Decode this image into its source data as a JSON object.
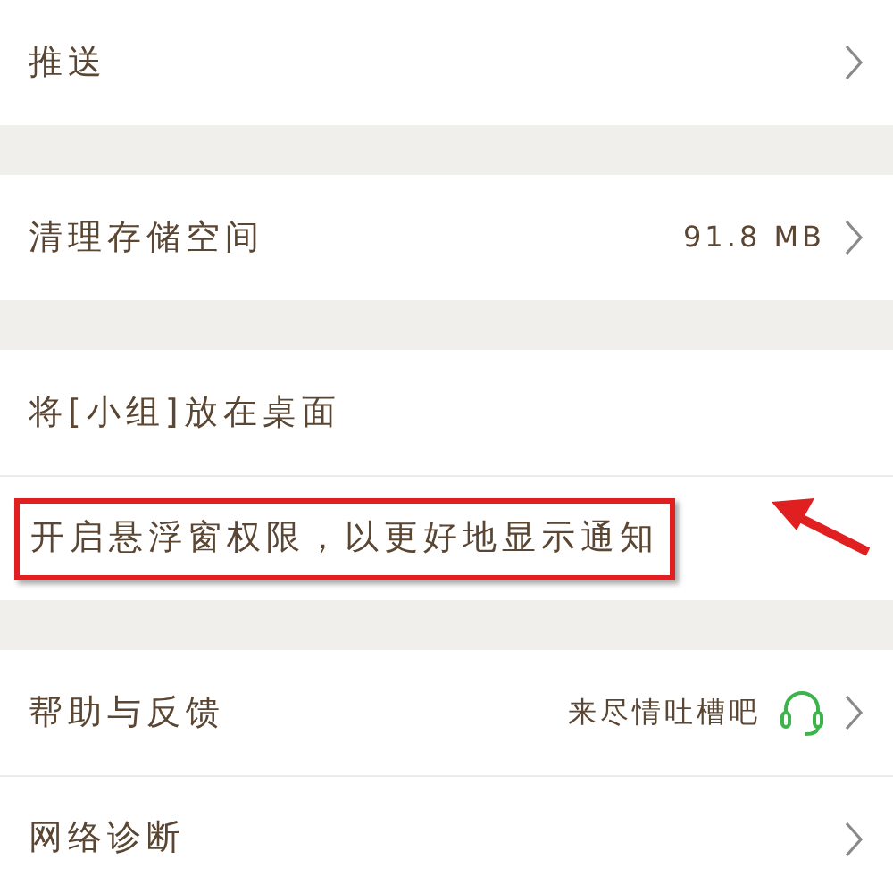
{
  "groups": [
    {
      "items": [
        {
          "label": "推送",
          "chevron": true,
          "headset": false,
          "highlighted": false
        }
      ]
    },
    {
      "items": [
        {
          "label": "清理存储空间",
          "value": "91.8 MB",
          "chevron": true,
          "headset": false,
          "highlighted": false
        }
      ]
    },
    {
      "items": [
        {
          "label": "将[小组]放在桌面",
          "chevron": false,
          "headset": false,
          "highlighted": false
        },
        {
          "label": "开启悬浮窗权限，以更好地显示通知",
          "chevron": false,
          "headset": false,
          "highlighted": true
        }
      ]
    },
    {
      "items": [
        {
          "label": "帮助与反馈",
          "value": "来尽情吐槽吧",
          "chevron": true,
          "headset": true,
          "highlighted": false
        },
        {
          "label": "网络诊断",
          "chevron": true,
          "headset": false,
          "highlighted": false
        }
      ]
    }
  ]
}
